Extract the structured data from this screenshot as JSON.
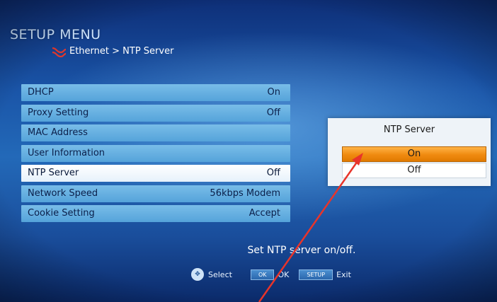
{
  "header": {
    "title": "SETUP MENU",
    "breadcrumb": "Ethernet > NTP Server"
  },
  "menu": {
    "items": [
      {
        "label": "DHCP",
        "value": "On"
      },
      {
        "label": "Proxy Setting",
        "value": "Off"
      },
      {
        "label": "MAC Address",
        "value": ""
      },
      {
        "label": "User Information",
        "value": ""
      },
      {
        "label": "NTP Server",
        "value": "Off"
      },
      {
        "label": "Network Speed",
        "value": "56kbps Modem"
      },
      {
        "label": "Cookie Setting",
        "value": "Accept"
      }
    ],
    "selected_label": "NTP Server"
  },
  "popup": {
    "title": "NTP Server",
    "options": [
      "On",
      "Off"
    ],
    "highlighted": "On"
  },
  "hint": "Set NTP server on/off.",
  "footer": {
    "select_label": "Select",
    "ok_key": "OK",
    "ok_label": "OK",
    "setup_key": "SETUP",
    "exit_label": "Exit"
  },
  "colors": {
    "highlight": "#f08a10",
    "menu_bar": "#5ba8dd",
    "background": "#1a55a8",
    "annotation_arrow": "#e8342a"
  },
  "icons": {
    "breadcrumb": "network-icon",
    "footer": "dpad-icon"
  }
}
